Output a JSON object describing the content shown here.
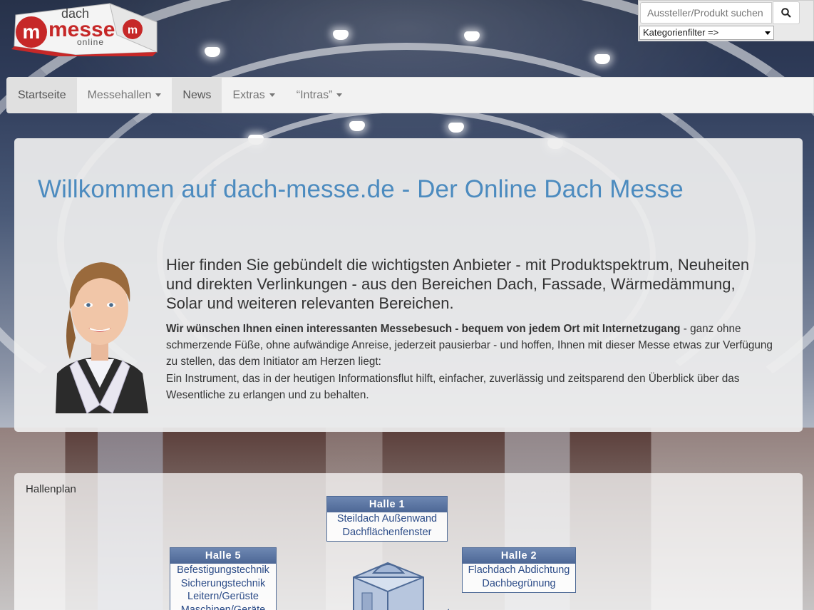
{
  "logo": {
    "alt": "dach messe online"
  },
  "search": {
    "placeholder": "Aussteller/Produkt suchen",
    "button_icon": "search-icon",
    "filter_value": "Kategorienfilter =>"
  },
  "nav": {
    "items": [
      {
        "label": "Startseite",
        "dropdown": false,
        "active": true
      },
      {
        "label": "Messehallen",
        "dropdown": true,
        "active": false
      },
      {
        "label": "News",
        "dropdown": false,
        "active": true
      },
      {
        "label": "Extras",
        "dropdown": true,
        "active": false
      },
      {
        "label": "“Intras”",
        "dropdown": true,
        "active": false
      }
    ]
  },
  "jumbotron": {
    "title": "Willkommen auf dach-messe.de - Der Online Dach Messe",
    "lead": "Hier finden Sie gebündelt die wichtigsten Anbieter - mit Produktspektrum, Neuheiten und direkten Verlinkungen - aus den Bereichen Dach, Fassade, Wärmedämmung, Solar und weiteren relevanten Bereichen.",
    "bold_intro": "Wir wünschen Ihnen einen interessanten Messebesuch - bequem von jedem Ort mit Internetzugang",
    "body_rest": " - ganz ohne schmerzende Füße, ohne aufwändige Anreise, jederzeit pausierbar - und hoffen, Ihnen mit dieser Messe etwas zur Verfügung zu stellen, das dem Initiator am Herzen liegt:",
    "body_second": "Ein Instrument, das in der heutigen Informationsflut hilft, einfacher, zuverlässig und zeitsparend den Überblick über das Wesentliche zu erlangen und zu behalten."
  },
  "hallenplan": {
    "title": "Hallenplan",
    "halls": [
      {
        "name": "Halle  1",
        "lines": [
          "Steildach Außenwand",
          "Dachflächenfenster"
        ]
      },
      {
        "name": "Halle  2",
        "lines": [
          "Flachdach Abdichtung",
          "Dachbegrünung"
        ]
      },
      {
        "name": "Halle  5",
        "lines": [
          "Befestigungstechnik",
          "Sicherungstechnik",
          "Leitern/Gerüste",
          "Maschinen/Geräte"
        ]
      }
    ]
  },
  "colors": {
    "title_blue": "#4c8bbf",
    "hall_header": "#5a74a2",
    "hall_text": "#2b4b87"
  }
}
